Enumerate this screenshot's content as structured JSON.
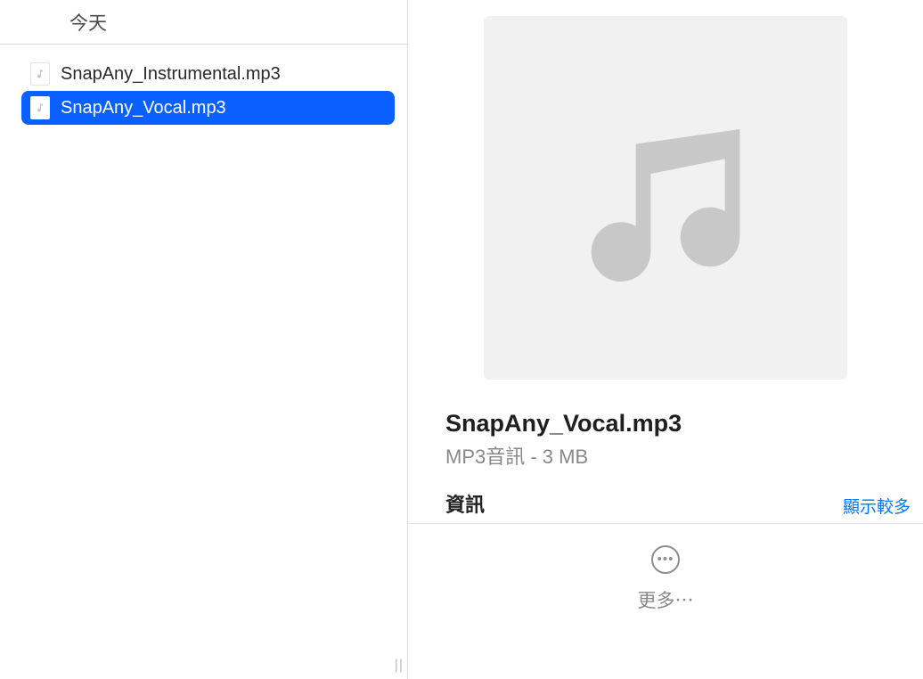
{
  "list": {
    "header": "今天",
    "items": [
      {
        "name": "SnapAny_Instrumental.mp3",
        "selected": false
      },
      {
        "name": "SnapAny_Vocal.mp3",
        "selected": true
      }
    ]
  },
  "preview": {
    "title": "SnapAny_Vocal.mp3",
    "subtitle": "MP3音訊 - 3 MB",
    "info_label": "資訊",
    "show_more": "顯示較多",
    "more_label": "更多⋯"
  },
  "colors": {
    "selection": "#0a60ff",
    "link": "#007aff"
  },
  "icons": {
    "file_item": "music-note-icon",
    "preview_thumb": "music-note-icon",
    "more_button": "ellipsis-circle-icon"
  }
}
